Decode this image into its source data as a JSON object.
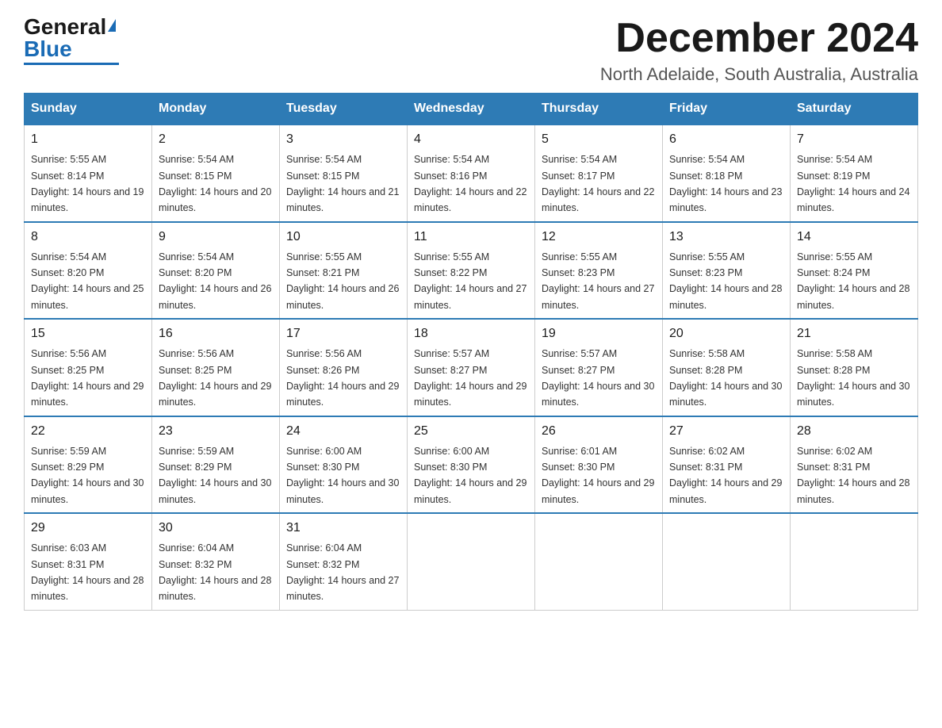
{
  "logo": {
    "general": "General",
    "blue": "Blue"
  },
  "header": {
    "month_title": "December 2024",
    "location": "North Adelaide, South Australia, Australia"
  },
  "days_of_week": [
    "Sunday",
    "Monday",
    "Tuesday",
    "Wednesday",
    "Thursday",
    "Friday",
    "Saturday"
  ],
  "weeks": [
    [
      {
        "day": "1",
        "sunrise": "5:55 AM",
        "sunset": "8:14 PM",
        "daylight": "14 hours and 19 minutes."
      },
      {
        "day": "2",
        "sunrise": "5:54 AM",
        "sunset": "8:15 PM",
        "daylight": "14 hours and 20 minutes."
      },
      {
        "day": "3",
        "sunrise": "5:54 AM",
        "sunset": "8:15 PM",
        "daylight": "14 hours and 21 minutes."
      },
      {
        "day": "4",
        "sunrise": "5:54 AM",
        "sunset": "8:16 PM",
        "daylight": "14 hours and 22 minutes."
      },
      {
        "day": "5",
        "sunrise": "5:54 AM",
        "sunset": "8:17 PM",
        "daylight": "14 hours and 22 minutes."
      },
      {
        "day": "6",
        "sunrise": "5:54 AM",
        "sunset": "8:18 PM",
        "daylight": "14 hours and 23 minutes."
      },
      {
        "day": "7",
        "sunrise": "5:54 AM",
        "sunset": "8:19 PM",
        "daylight": "14 hours and 24 minutes."
      }
    ],
    [
      {
        "day": "8",
        "sunrise": "5:54 AM",
        "sunset": "8:20 PM",
        "daylight": "14 hours and 25 minutes."
      },
      {
        "day": "9",
        "sunrise": "5:54 AM",
        "sunset": "8:20 PM",
        "daylight": "14 hours and 26 minutes."
      },
      {
        "day": "10",
        "sunrise": "5:55 AM",
        "sunset": "8:21 PM",
        "daylight": "14 hours and 26 minutes."
      },
      {
        "day": "11",
        "sunrise": "5:55 AM",
        "sunset": "8:22 PM",
        "daylight": "14 hours and 27 minutes."
      },
      {
        "day": "12",
        "sunrise": "5:55 AM",
        "sunset": "8:23 PM",
        "daylight": "14 hours and 27 minutes."
      },
      {
        "day": "13",
        "sunrise": "5:55 AM",
        "sunset": "8:23 PM",
        "daylight": "14 hours and 28 minutes."
      },
      {
        "day": "14",
        "sunrise": "5:55 AM",
        "sunset": "8:24 PM",
        "daylight": "14 hours and 28 minutes."
      }
    ],
    [
      {
        "day": "15",
        "sunrise": "5:56 AM",
        "sunset": "8:25 PM",
        "daylight": "14 hours and 29 minutes."
      },
      {
        "day": "16",
        "sunrise": "5:56 AM",
        "sunset": "8:25 PM",
        "daylight": "14 hours and 29 minutes."
      },
      {
        "day": "17",
        "sunrise": "5:56 AM",
        "sunset": "8:26 PM",
        "daylight": "14 hours and 29 minutes."
      },
      {
        "day": "18",
        "sunrise": "5:57 AM",
        "sunset": "8:27 PM",
        "daylight": "14 hours and 29 minutes."
      },
      {
        "day": "19",
        "sunrise": "5:57 AM",
        "sunset": "8:27 PM",
        "daylight": "14 hours and 30 minutes."
      },
      {
        "day": "20",
        "sunrise": "5:58 AM",
        "sunset": "8:28 PM",
        "daylight": "14 hours and 30 minutes."
      },
      {
        "day": "21",
        "sunrise": "5:58 AM",
        "sunset": "8:28 PM",
        "daylight": "14 hours and 30 minutes."
      }
    ],
    [
      {
        "day": "22",
        "sunrise": "5:59 AM",
        "sunset": "8:29 PM",
        "daylight": "14 hours and 30 minutes."
      },
      {
        "day": "23",
        "sunrise": "5:59 AM",
        "sunset": "8:29 PM",
        "daylight": "14 hours and 30 minutes."
      },
      {
        "day": "24",
        "sunrise": "6:00 AM",
        "sunset": "8:30 PM",
        "daylight": "14 hours and 30 minutes."
      },
      {
        "day": "25",
        "sunrise": "6:00 AM",
        "sunset": "8:30 PM",
        "daylight": "14 hours and 29 minutes."
      },
      {
        "day": "26",
        "sunrise": "6:01 AM",
        "sunset": "8:30 PM",
        "daylight": "14 hours and 29 minutes."
      },
      {
        "day": "27",
        "sunrise": "6:02 AM",
        "sunset": "8:31 PM",
        "daylight": "14 hours and 29 minutes."
      },
      {
        "day": "28",
        "sunrise": "6:02 AM",
        "sunset": "8:31 PM",
        "daylight": "14 hours and 28 minutes."
      }
    ],
    [
      {
        "day": "29",
        "sunrise": "6:03 AM",
        "sunset": "8:31 PM",
        "daylight": "14 hours and 28 minutes."
      },
      {
        "day": "30",
        "sunrise": "6:04 AM",
        "sunset": "8:32 PM",
        "daylight": "14 hours and 28 minutes."
      },
      {
        "day": "31",
        "sunrise": "6:04 AM",
        "sunset": "8:32 PM",
        "daylight": "14 hours and 27 minutes."
      },
      null,
      null,
      null,
      null
    ]
  ],
  "labels": {
    "sunrise": "Sunrise:",
    "sunset": "Sunset:",
    "daylight": "Daylight:"
  }
}
